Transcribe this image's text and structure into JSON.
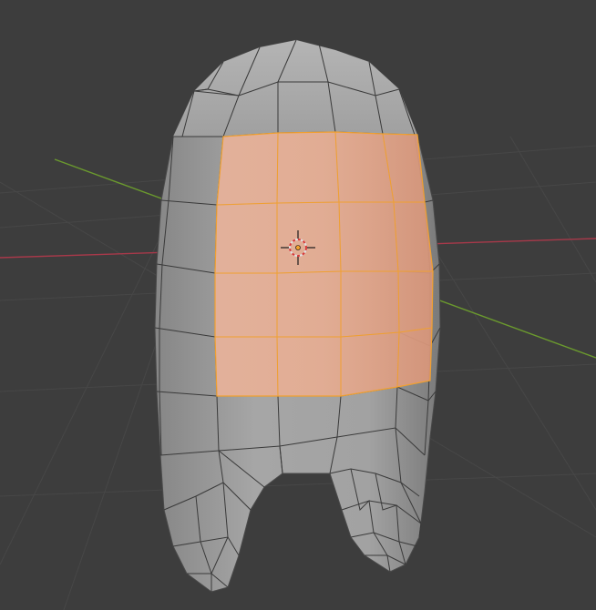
{
  "viewport": {
    "mode": "edit-mode",
    "selected_faces": 16,
    "colors": {
      "background": "#3d3d3d",
      "grid": "#4a4a4a",
      "x_axis": "#a8394a",
      "y_axis": "#6b9a2e",
      "mesh_fill": "#9c9c9c",
      "mesh_edge": "#3a3a3a",
      "selection_fill": "#e9a47e",
      "selection_edge": "#f0a030",
      "cursor_ring": "#d8d8d8",
      "cursor_dash": "#d83a3a"
    },
    "icons": {
      "cursor": "3d-cursor-icon",
      "origin": "object-origin-icon"
    }
  }
}
